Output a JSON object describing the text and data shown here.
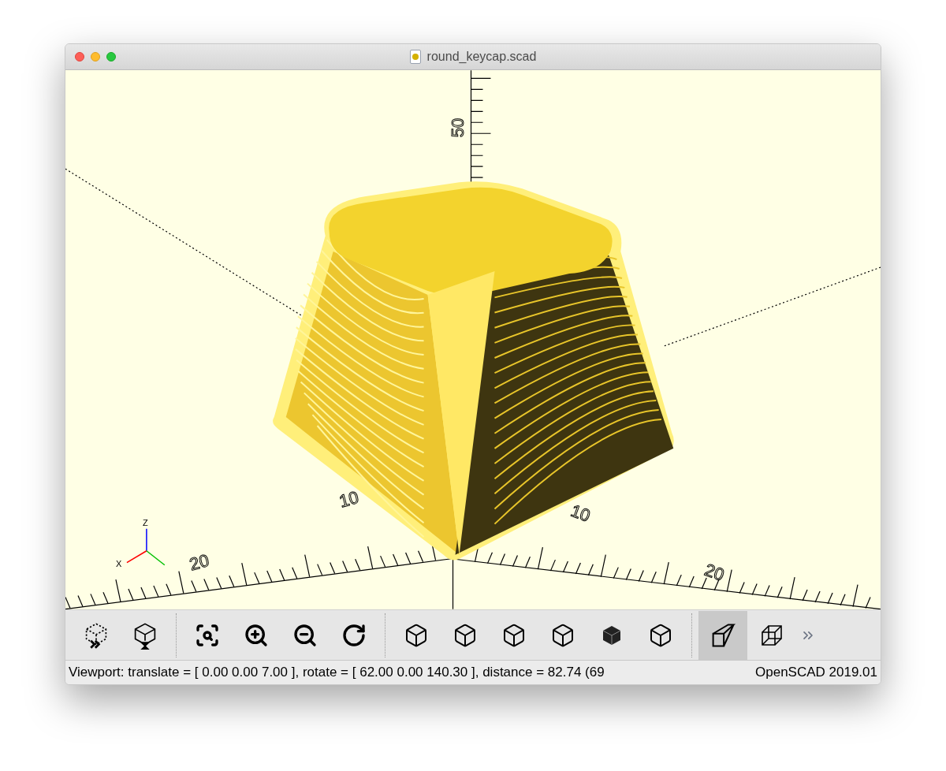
{
  "window": {
    "title": "round_keycap.scad"
  },
  "viewport": {
    "z_axis_labels": [
      "50"
    ],
    "x_axis_labels": [
      "10",
      "20"
    ],
    "y_axis_labels": [
      "10",
      "20"
    ],
    "indicator": {
      "z": "Z",
      "x": "X"
    }
  },
  "toolbar": [
    {
      "kind": "preview",
      "selected": false
    },
    {
      "kind": "render",
      "selected": false
    },
    {
      "kind": "view-all",
      "selected": false
    },
    {
      "kind": "zoom-in",
      "selected": false
    },
    {
      "kind": "zoom-out",
      "selected": false
    },
    {
      "kind": "reset-view",
      "selected": false
    },
    {
      "kind": "view-right",
      "selected": false
    },
    {
      "kind": "view-top",
      "selected": false
    },
    {
      "kind": "view-bottom",
      "selected": false
    },
    {
      "kind": "view-left",
      "selected": false
    },
    {
      "kind": "view-front",
      "selected": false
    },
    {
      "kind": "view-back",
      "selected": false
    },
    {
      "kind": "perspective",
      "selected": true
    },
    {
      "kind": "orthogonal",
      "selected": false
    },
    {
      "kind": "more",
      "selected": false
    }
  ],
  "status_bar": {
    "viewport": "Viewport: translate = [ 0.00 0.00 7.00 ], rotate = [ 62.00 0.00 140.30 ], distance = 82.74 (69",
    "version": "OpenSCAD 2019.01"
  }
}
